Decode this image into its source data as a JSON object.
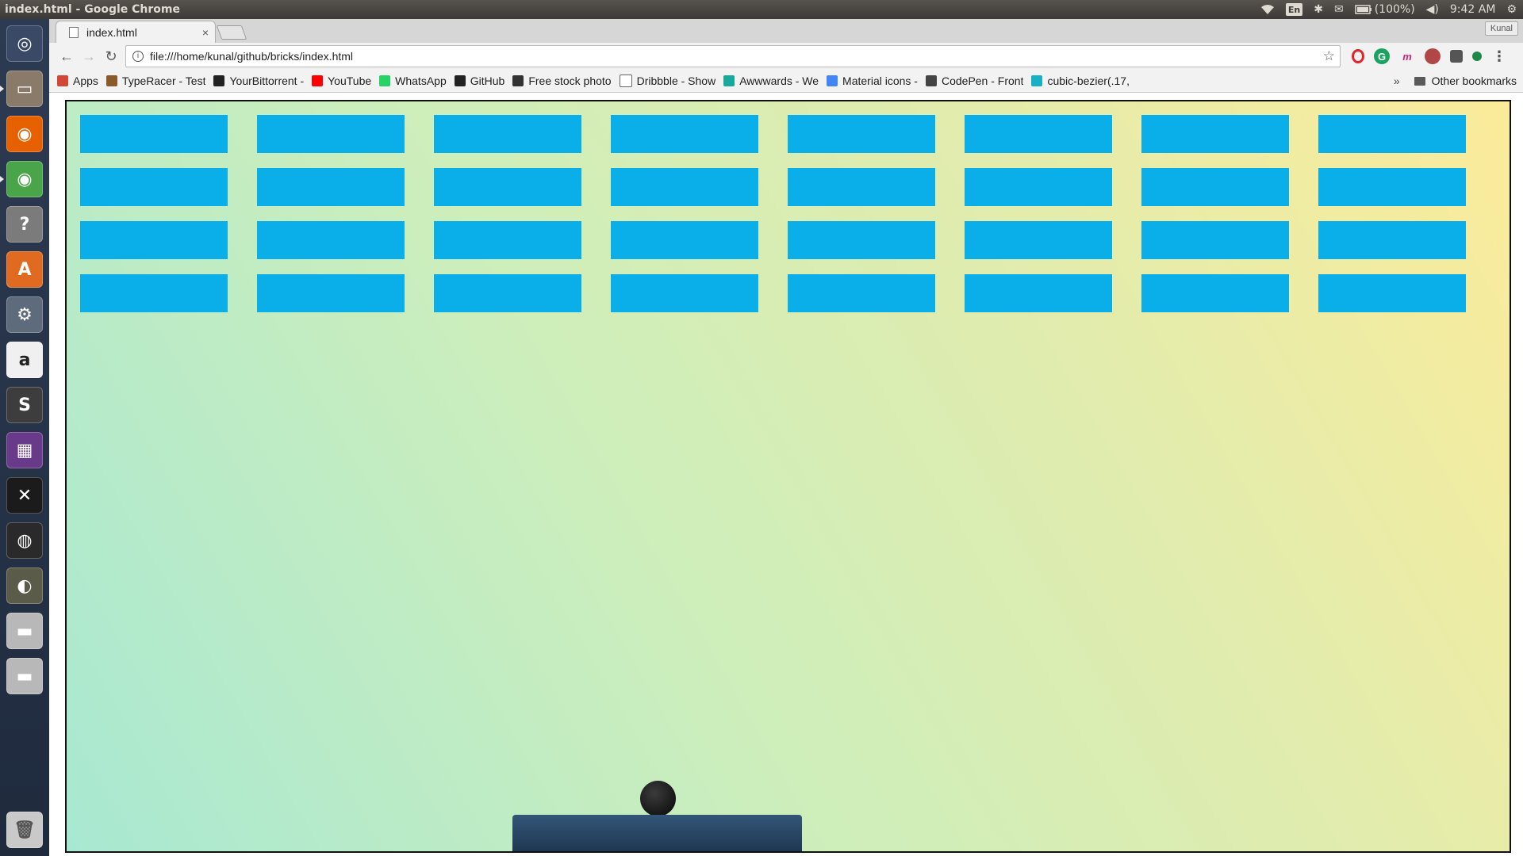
{
  "os": {
    "window_title": "index.html - Google Chrome",
    "clock": "9:42 AM",
    "battery": "(100%)",
    "keyboard_layout": "En",
    "user": "Kunal"
  },
  "launcher": {
    "items": [
      {
        "name": "ubuntu-dash-icon",
        "glyph": "◎",
        "color": "#3a4a66"
      },
      {
        "name": "files-icon",
        "glyph": "▭",
        "color": "#8a7a6a"
      },
      {
        "name": "firefox-icon",
        "glyph": "◉",
        "color": "#e66000"
      },
      {
        "name": "chrome-icon",
        "glyph": "◉",
        "color": "#4aa44a"
      },
      {
        "name": "help-icon",
        "glyph": "?",
        "color": "#7b7b7b"
      },
      {
        "name": "software-center-icon",
        "glyph": "A",
        "color": "#e06a1f"
      },
      {
        "name": "system-settings-icon",
        "glyph": "⚙",
        "color": "#5d6b7d"
      },
      {
        "name": "amazon-icon",
        "glyph": "a",
        "color": "#f0f0f0"
      },
      {
        "name": "sublime-text-icon",
        "glyph": "S",
        "color": "#3d3d3d"
      },
      {
        "name": "video-editor-icon",
        "glyph": "▦",
        "color": "#6a3a8a"
      },
      {
        "name": "xchat-icon",
        "glyph": "✕",
        "color": "#1b1b1b"
      },
      {
        "name": "webcam-icon",
        "glyph": "◍",
        "color": "#2a2a2a"
      },
      {
        "name": "gimp-icon",
        "glyph": "◐",
        "color": "#5b5b4a"
      },
      {
        "name": "drive-icon",
        "glyph": "▬",
        "color": "#b8b8b8"
      },
      {
        "name": "drive-icon-2",
        "glyph": "▬",
        "color": "#b8b8b8"
      }
    ],
    "trash_glyph": "🗑"
  },
  "browser": {
    "tab_title": "index.html",
    "tab_close": "×",
    "url": "file:///home/kunal/github/bricks/index.html",
    "bookmarks": [
      {
        "label": "Apps",
        "color": "#d14836"
      },
      {
        "label": "TypeRacer - Test",
        "color": "#8b5a2b"
      },
      {
        "label": "YourBittorrent -",
        "color": "#222222"
      },
      {
        "label": "YouTube",
        "color": "#ff0000"
      },
      {
        "label": "WhatsApp",
        "color": "#25d366"
      },
      {
        "label": "GitHub",
        "color": "#222222"
      },
      {
        "label": "Free stock photo",
        "color": "#333333"
      },
      {
        "label": "Dribbble - Show",
        "color": "#ffffff"
      },
      {
        "label": "Awwwards - We",
        "color": "#16a99c"
      },
      {
        "label": "Material icons -",
        "color": "#4285f4"
      },
      {
        "label": "CodePen - Front",
        "color": "#444444"
      },
      {
        "label": "cubic-bezier(.17,",
        "color": "#17b0c4"
      }
    ],
    "bookmarks_more": "»",
    "other_bookmarks": "Other bookmarks"
  },
  "game": {
    "brick_color": "#0aaee8",
    "bricks": {
      "rows": 4,
      "cols": 8
    }
  }
}
